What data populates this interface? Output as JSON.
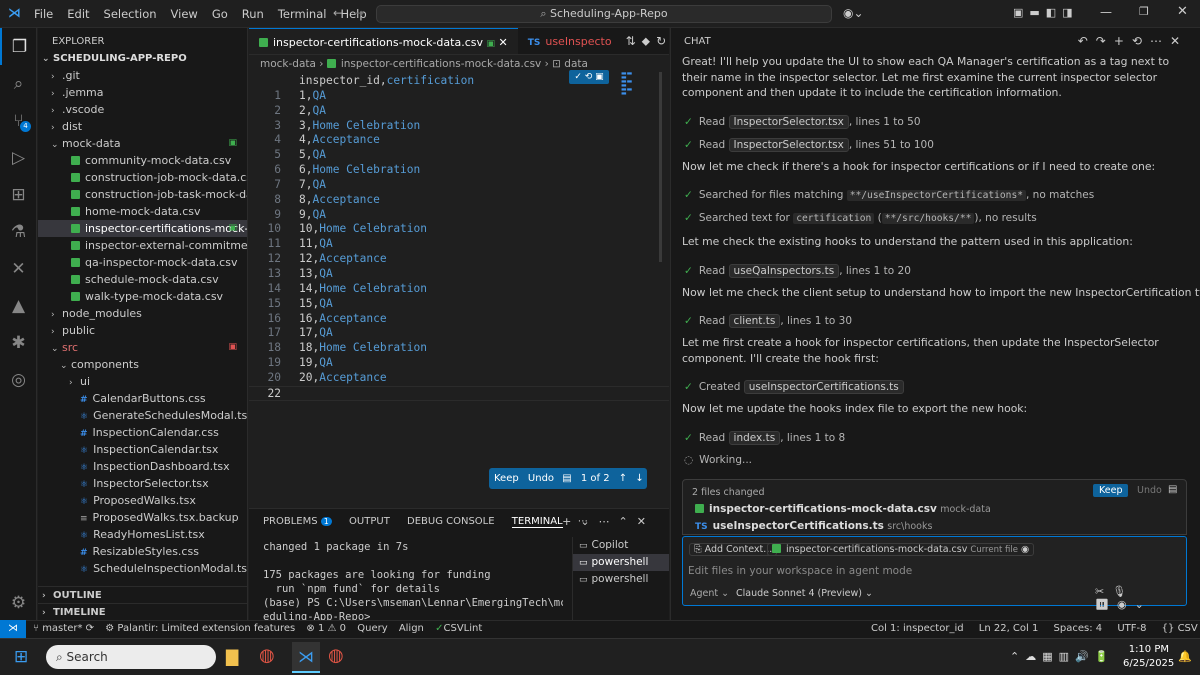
{
  "menu": [
    "File",
    "Edit",
    "Selection",
    "View",
    "Go",
    "Run",
    "Terminal",
    "Help"
  ],
  "command_center": "Scheduling-App-Repo",
  "explorer": {
    "header": "EXPLORER",
    "root": "SCHEDULING-APP-REPO",
    "items": [
      {
        "label": ".git",
        "kind": "folder",
        "indent": 1
      },
      {
        "label": ".jemma",
        "kind": "folder",
        "indent": 1
      },
      {
        "label": ".vscode",
        "kind": "folder",
        "indent": 1
      },
      {
        "label": "dist",
        "kind": "folder",
        "indent": 1
      },
      {
        "label": "mock-data",
        "kind": "folder-open",
        "indent": 1
      },
      {
        "label": "community-mock-data.csv",
        "kind": "csv",
        "indent": 2
      },
      {
        "label": "construction-job-mock-data.csv",
        "kind": "csv",
        "indent": 2
      },
      {
        "label": "construction-job-task-mock-data.csv",
        "kind": "csv",
        "indent": 2
      },
      {
        "label": "home-mock-data.csv",
        "kind": "csv",
        "indent": 2
      },
      {
        "label": "inspector-certifications-mock-d...",
        "kind": "csv",
        "indent": 2,
        "selected": true
      },
      {
        "label": "inspector-external-commitments-mo...",
        "kind": "csv",
        "indent": 2
      },
      {
        "label": "qa-inspector-mock-data.csv",
        "kind": "csv",
        "indent": 2
      },
      {
        "label": "schedule-mock-data.csv",
        "kind": "csv",
        "indent": 2
      },
      {
        "label": "walk-type-mock-data.csv",
        "kind": "csv",
        "indent": 2
      },
      {
        "label": "node_modules",
        "kind": "folder",
        "indent": 1
      },
      {
        "label": "public",
        "kind": "folder",
        "indent": 1
      },
      {
        "label": "src",
        "kind": "folder-open",
        "indent": 1
      },
      {
        "label": "components",
        "kind": "folder-open",
        "indent": 2
      },
      {
        "label": "ui",
        "kind": "folder",
        "indent": 3
      },
      {
        "label": "CalendarButtons.css",
        "kind": "css",
        "indent": 3
      },
      {
        "label": "GenerateSchedulesModal.tsx",
        "kind": "tsx",
        "indent": 3
      },
      {
        "label": "InspectionCalendar.css",
        "kind": "css",
        "indent": 3
      },
      {
        "label": "InspectionCalendar.tsx",
        "kind": "tsx",
        "indent": 3
      },
      {
        "label": "InspectionDashboard.tsx",
        "kind": "tsx",
        "indent": 3
      },
      {
        "label": "InspectorSelector.tsx",
        "kind": "tsx",
        "indent": 3
      },
      {
        "label": "ProposedWalks.tsx",
        "kind": "tsx",
        "indent": 3
      },
      {
        "label": "ProposedWalks.tsx.backup",
        "kind": "file",
        "indent": 3
      },
      {
        "label": "ReadyHomesList.tsx",
        "kind": "tsx",
        "indent": 3
      },
      {
        "label": "ResizableStyles.css",
        "kind": "css",
        "indent": 3
      },
      {
        "label": "ScheduleInspectionModal.tsx",
        "kind": "tsx",
        "indent": 3
      }
    ],
    "outline": "OUTLINE",
    "timeline": "TIMELINE"
  },
  "editor": {
    "tab_active": "inspector-certifications-mock-data.csv",
    "tab_other": "useInspecto",
    "breadcrumb": [
      "mock-data",
      "inspector-certifications-mock-data.csv",
      "data"
    ],
    "header_line": {
      "a": "inspector_id",
      "b": "certification"
    },
    "rows": [
      [
        "1",
        "QA"
      ],
      [
        "2",
        "QA"
      ],
      [
        "3",
        "Home Celebration"
      ],
      [
        "4",
        "Acceptance"
      ],
      [
        "5",
        "QA"
      ],
      [
        "6",
        "Home Celebration"
      ],
      [
        "7",
        "QA"
      ],
      [
        "8",
        "Acceptance"
      ],
      [
        "9",
        "QA"
      ],
      [
        "10",
        "Home Celebration"
      ],
      [
        "11",
        "QA"
      ],
      [
        "12",
        "Acceptance"
      ],
      [
        "13",
        "QA"
      ],
      [
        "14",
        "Home Celebration"
      ],
      [
        "15",
        "QA"
      ],
      [
        "16",
        "Acceptance"
      ],
      [
        "17",
        "QA"
      ],
      [
        "18",
        "Home Celebration"
      ],
      [
        "19",
        "QA"
      ],
      [
        "20",
        "Acceptance"
      ]
    ],
    "last_line_number": "22",
    "review_bar": {
      "keep": "Keep",
      "undo": "Undo",
      "count": "1 of 2"
    }
  },
  "panel": {
    "tabs": [
      "PROBLEMS",
      "OUTPUT",
      "DEBUG CONSOLE",
      "TERMINAL"
    ],
    "problems_count": "1",
    "terminal_lines": [
      "changed 1 package in 7s",
      "",
      "175 packages are looking for funding",
      "  run `npm fund` for details",
      "(base) PS C:\\Users\\mseman\\Lennar\\EmergingTech\\mcp\\Sch",
      "eduling-App-Repo> "
    ],
    "terminals": [
      "Copilot",
      "powershell",
      "powershell"
    ]
  },
  "chat": {
    "title": "CHAT",
    "intro": "Great! I'll help you update the UI to show each QA Manager's certification as a tag next to their name in the inspector selector. Let me first examine the current inspector selector component and then update it to include the certification information.",
    "read1": {
      "verb": "Read",
      "file": "InspectorSelector.tsx",
      "rest": ", lines 1 to 50"
    },
    "read2": {
      "verb": "Read",
      "file": "InspectorSelector.tsx",
      "rest": ", lines 51 to 100"
    },
    "msg2": "Now let me check if there's a hook for inspector certifications or if I need to create one:",
    "search1": {
      "pre": "Searched for files matching",
      "code": "**/useInspectorCertifications*",
      "rest": ", no matches"
    },
    "search2": {
      "pre": "Searched text for",
      "code": "certification",
      "code2": "**/src/hooks/**",
      "rest": ", no results"
    },
    "msg3": "Let me check the existing hooks to understand the pattern used in this application:",
    "read3": {
      "verb": "Read",
      "file": "useQaInspectors.ts",
      "rest": ", lines 1 to 20"
    },
    "msg4": "Now let me check the client setup to understand how to import the new InspectorCertification type:",
    "read4": {
      "verb": "Read",
      "file": "client.ts",
      "rest": ", lines 1 to 30"
    },
    "msg5": "Let me first create a hook for inspector certifications, then update the InspectorSelector component. I'll create the hook first:",
    "created": {
      "verb": "Created",
      "file": "useInspectorCertifications.ts"
    },
    "msg6": "Now let me update the hooks index file to export the new hook:",
    "read5": {
      "verb": "Read",
      "file": "index.ts",
      "rest": ", lines 1 to 8"
    },
    "working": "Working...",
    "changes": {
      "header": "2 files changed",
      "keep": "Keep",
      "undo": "Undo",
      "files": [
        {
          "name": "inspector-certifications-mock-data.csv",
          "path": "mock-data"
        },
        {
          "name": "useInspectorCertifications.ts",
          "path": "src\\hooks"
        }
      ]
    },
    "input": {
      "add_context": "Add Context...",
      "context_file": "inspector-certifications-mock-data.csv",
      "context_tag": "Current file",
      "placeholder": "Edit files in your workspace in agent mode",
      "mode": "Agent",
      "model": "Claude Sonnet 4 (Preview)"
    }
  },
  "status": {
    "branch": "master*",
    "extension": "Palantir: Limited extension features",
    "errors": "1",
    "warnings": "0",
    "query": "Query",
    "align": "Align",
    "csvlint": "CSVLint",
    "col": "Col 1: inspector_id",
    "position": "Ln 22, Col 1",
    "spaces": "Spaces: 4",
    "encoding": "UTF-8",
    "language": "CSV"
  },
  "taskbar": {
    "search": "Search",
    "time": "1:10 PM",
    "date": "6/25/2025"
  }
}
